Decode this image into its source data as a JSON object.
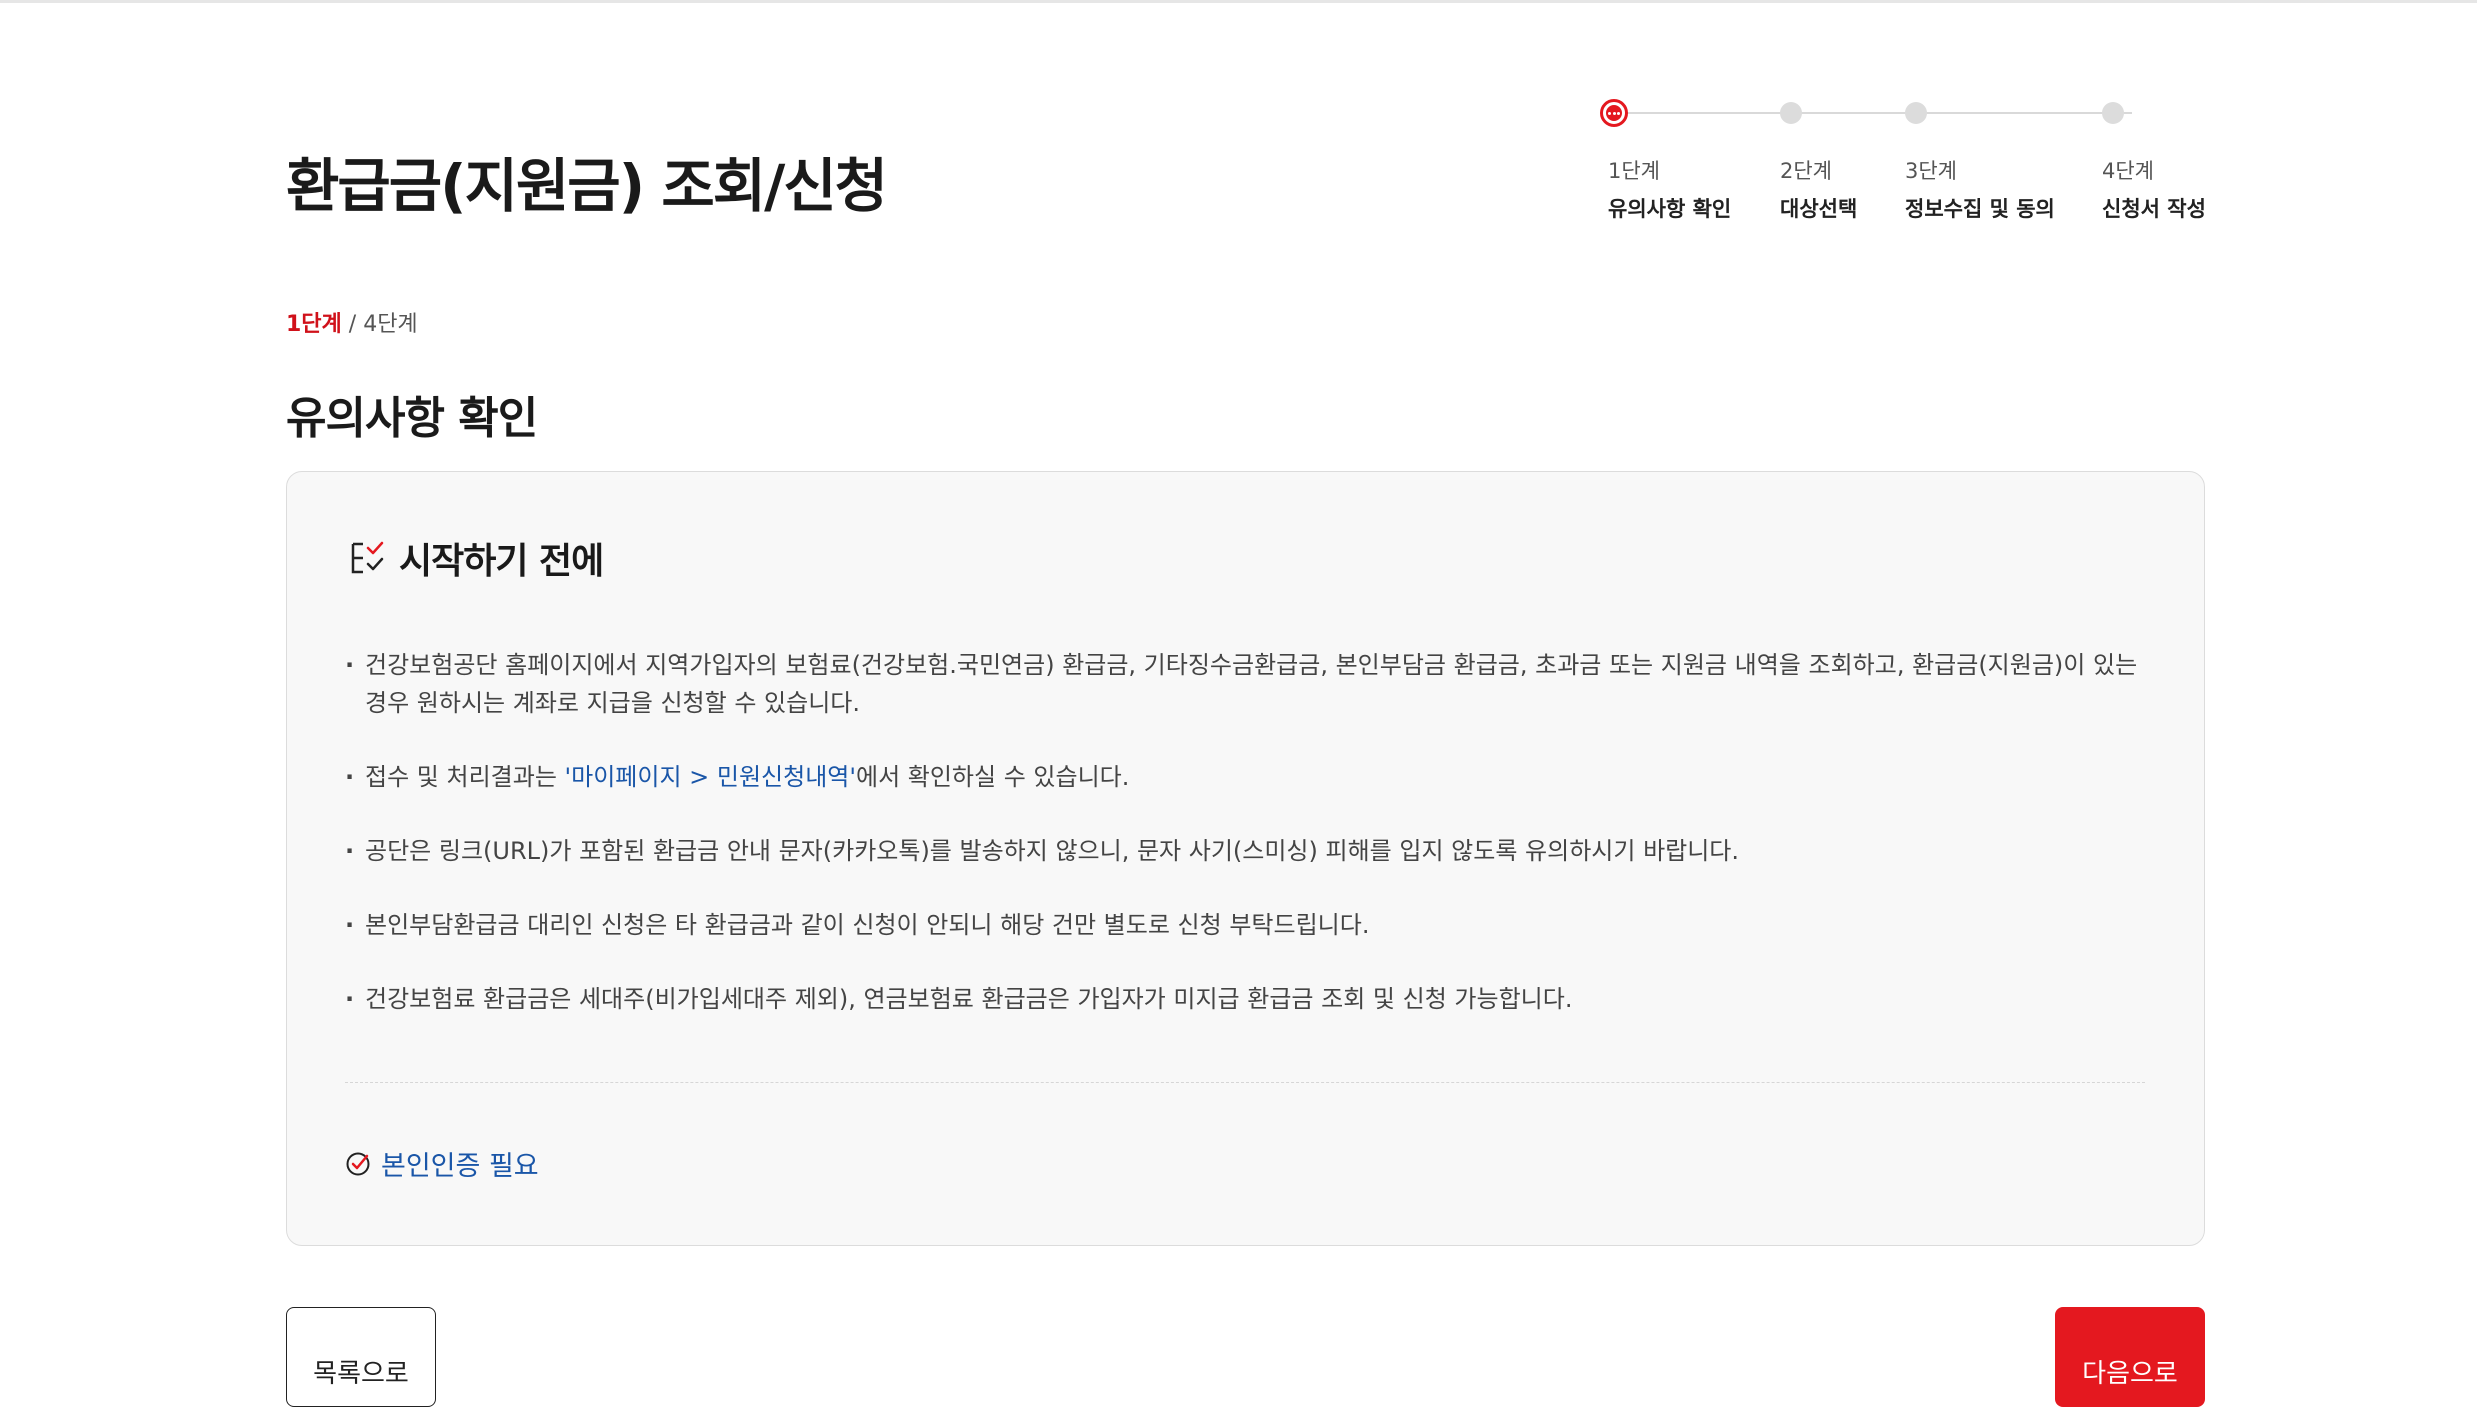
{
  "page": {
    "title": "환급금(지원금) 조회/신청"
  },
  "stepper": {
    "steps": [
      {
        "num": "1단계",
        "label": "유의사항 확인",
        "active": true
      },
      {
        "num": "2단계",
        "label": "대상선택",
        "active": false
      },
      {
        "num": "3단계",
        "label": "정보수집 및 동의",
        "active": false
      },
      {
        "num": "4단계",
        "label": "신청서 작성",
        "active": false
      }
    ]
  },
  "section": {
    "stage_current": "1단계",
    "stage_total": " / 4단계",
    "title": "유의사항 확인"
  },
  "notice": {
    "heading": "시작하기 전에",
    "items": [
      "건강보험공단 홈페이지에서 지역가입자의 보험료(건강보험.국민연금) 환급금, 기타징수금환급금, 본인부담금 환급금, 초과금 또는 지원금 내역을 조회하고, 환급금(지원금)이 있는 경우 원하시는 계좌로 지급을 신청할 수 있습니다.",
      "공단은 링크(URL)가 포함된 환급금 안내 문자(카카오톡)를 발송하지 않으니, 문자 사기(스미싱) 피해를 입지 않도록 유의하시기 바랍니다.",
      "본인부담환급금 대리인 신청은 타 환급금과 같이 신청이 안되니 해당 건만 별도로 신청 부탁드립니다.",
      "건강보험료 환급금은 세대주(비가입세대주 제외), 연금보험료 환급금은 가입자가 미지급 환급금 조회 및 신청 가능합니다."
    ],
    "item2_prefix": "접수 및 처리결과는 ",
    "item2_link": "'마이페이지 > 민원신청내역'",
    "item2_suffix": "에서 확인하실 수 있습니다.",
    "auth_required": "본인인증 필요",
    "accent_color": "#1a56a8"
  },
  "buttons": {
    "list": "목록으로",
    "next": "다음으로",
    "next_color": "#e4181f"
  }
}
